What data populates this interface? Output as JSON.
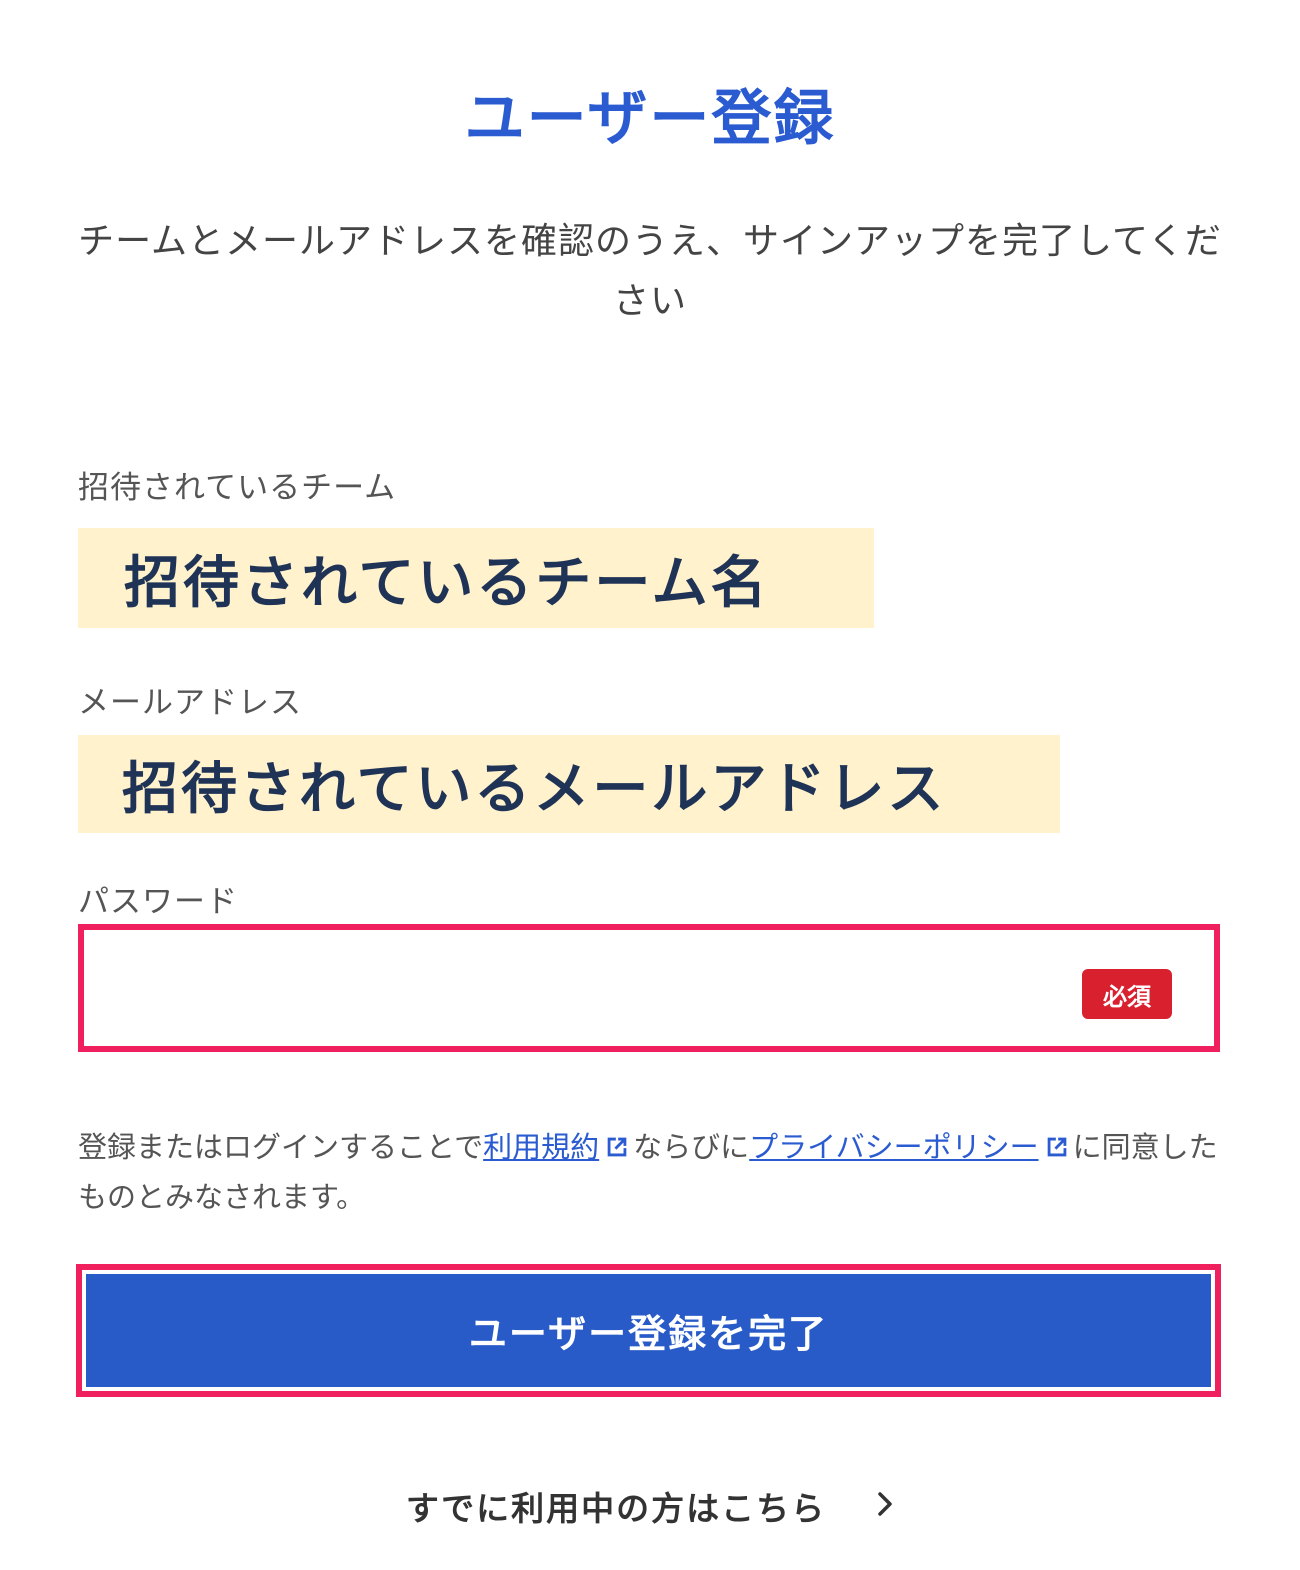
{
  "page": {
    "title": "ユーザー登録",
    "subtitle": "チームとメールアドレスを確認のうえ、サインアップを完了してください"
  },
  "team": {
    "label": "招待されているチーム",
    "value": "招待されているチーム名"
  },
  "email": {
    "label": "メールアドレス",
    "value": "招待されているメールアドレス"
  },
  "password": {
    "label": "パスワード",
    "value": "",
    "required_badge": "必須"
  },
  "consent": {
    "prefix": "登録またはログインすることで",
    "terms_link": "利用規約",
    "middle": "ならびに",
    "privacy_link": "プライバシーポリシー",
    "suffix": "に同意したものとみなされます。"
  },
  "submit": {
    "label": "ユーザー登録を完了"
  },
  "login": {
    "label": "すでに利用中の方はこちら"
  },
  "colors": {
    "title": "#2a5bd0",
    "button": "#285bc7",
    "highlight_border": "#f0205f",
    "required_badge": "#d8202f",
    "readonly_background": "#fff2cc"
  },
  "icons": {
    "external_link": "external-link-icon",
    "chevron": "chevron-right-icon"
  }
}
